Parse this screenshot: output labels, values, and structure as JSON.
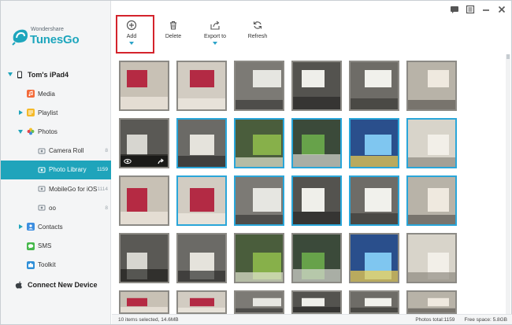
{
  "app": {
    "brand_small": "Wondershare",
    "brand_big": "TunesGo",
    "accent": "#1fa4bb"
  },
  "window_controls": [
    {
      "name": "message-icon"
    },
    {
      "name": "menu-icon"
    },
    {
      "name": "minimize-icon"
    },
    {
      "name": "close-icon"
    }
  ],
  "sidebar": {
    "device": "Tom's iPad4",
    "items": [
      {
        "label": "Media",
        "count": "",
        "level": 1,
        "icon": "music-icon"
      },
      {
        "label": "Playlist",
        "count": "",
        "level": 1,
        "icon": "playlist-icon",
        "expandable": true
      },
      {
        "label": "Photos",
        "count": "",
        "level": 1,
        "icon": "photos-icon",
        "expanded": true
      },
      {
        "label": "Camera Roll",
        "count": "8",
        "level": 2,
        "icon": "album-icon"
      },
      {
        "label": "Photo Library",
        "count": "1159",
        "level": 2,
        "icon": "album-icon",
        "selected": true
      },
      {
        "label": "MobileGo for iOS",
        "count": "1114",
        "level": 2,
        "icon": "album-icon"
      },
      {
        "label": "oo",
        "count": "8",
        "level": 2,
        "icon": "album-icon"
      },
      {
        "label": "Contacts",
        "count": "",
        "level": 1,
        "icon": "contacts-icon",
        "expandable": true
      },
      {
        "label": "SMS",
        "count": "",
        "level": 1,
        "icon": "sms-icon"
      },
      {
        "label": "Toolkit",
        "count": "",
        "level": 1,
        "icon": "toolkit-icon"
      }
    ],
    "connect_new": "Connect New Device"
  },
  "toolbar": {
    "add": "Add",
    "delete": "Delete",
    "export": "Export to",
    "refresh": "Refresh"
  },
  "status": {
    "selected": "10 items selected, 14.6MB",
    "photos_total": "Photos total:1159",
    "free_space": "Free space: 5.8GB"
  }
}
